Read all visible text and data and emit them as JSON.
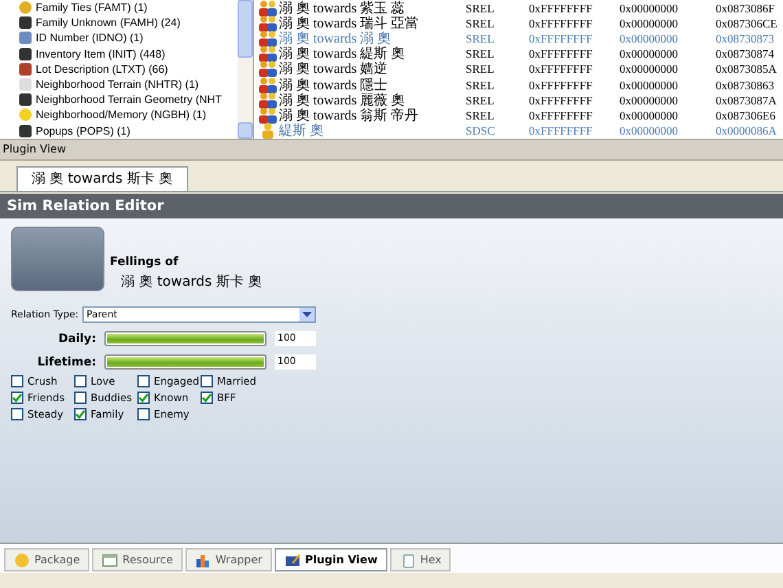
{
  "tree": {
    "items": [
      {
        "label": "Family Ties (FAMT) (1)",
        "kind": "people"
      },
      {
        "label": "Family Unknown (FAMH) (24)",
        "kind": "cube"
      },
      {
        "label": "ID Number (IDNO) (1)",
        "kind": "card"
      },
      {
        "label": "Inventory Item (INIT) (448)",
        "kind": "cube"
      },
      {
        "label": "Lot Description (LTXT) (66)",
        "kind": "house"
      },
      {
        "label": "Neighborhood Terrain (NHTR) (1)",
        "kind": "page"
      },
      {
        "label": "Neighborhood Terrain Geometry (NHT",
        "kind": "cube"
      },
      {
        "label": "Neighborhood/Memory (NGBH) (1)",
        "kind": "bulb"
      },
      {
        "label": "Popups (POPS) (1)",
        "kind": "cube"
      }
    ]
  },
  "resources": {
    "rows": [
      {
        "kind": "pair",
        "highlighted": false,
        "cells": [
          "溺 奧 towards 紫玉 蕊",
          "SREL",
          "0xFFFFFFFF",
          "0x00000000",
          "0x0873086F"
        ]
      },
      {
        "kind": "pair",
        "highlighted": false,
        "cells": [
          "溺 奧 towards 瑞斗 亞當",
          "SREL",
          "0xFFFFFFFF",
          "0x00000000",
          "0x087306CE"
        ]
      },
      {
        "kind": "pair",
        "highlighted": true,
        "cells": [
          "溺 奧 towards 溺 奧",
          "SREL",
          "0xFFFFFFFF",
          "0x00000000",
          "0x08730873"
        ]
      },
      {
        "kind": "pair",
        "highlighted": false,
        "cells": [
          "溺 奧 towards 緹斯 奧",
          "SREL",
          "0xFFFFFFFF",
          "0x00000000",
          "0x08730874"
        ]
      },
      {
        "kind": "pair",
        "highlighted": false,
        "cells": [
          "溺 奧 towards 嫱逆",
          "SREL",
          "0xFFFFFFFF",
          "0x00000000",
          "0x0873085A"
        ]
      },
      {
        "kind": "pair",
        "highlighted": false,
        "cells": [
          "溺 奧 towards 隱士",
          "SREL",
          "0xFFFFFFFF",
          "0x00000000",
          "0x08730863"
        ]
      },
      {
        "kind": "pair",
        "highlighted": false,
        "cells": [
          "溺 奧 towards 麗薇 奧",
          "SREL",
          "0xFFFFFFFF",
          "0x00000000",
          "0x0873087A"
        ]
      },
      {
        "kind": "pair",
        "highlighted": false,
        "cells": [
          "溺 奧 towards 翁斯 帝丹",
          "SREL",
          "0xFFFFFFFF",
          "0x00000000",
          "0x087306E6"
        ]
      },
      {
        "kind": "single",
        "highlighted": true,
        "cells": [
          "緹斯 奧",
          "SDSC",
          "0xFFFFFFFF",
          "0x00000000",
          "0x0000086A"
        ]
      }
    ]
  },
  "plugin_view": {
    "title": "Plugin View",
    "tab": "溺 奧 towards 斯卡 奧"
  },
  "editor": {
    "title": "Sim Relation Editor",
    "heading": "Fellings of",
    "subject": "溺 奧 towards 斯卡 奧",
    "relation_type": {
      "label": "Relation Type:",
      "value": "Parent"
    },
    "meters": [
      {
        "label": "Daily:",
        "level": 1.0,
        "reading": "100"
      },
      {
        "label": "Lifetime:",
        "level": 1.0,
        "reading": "100"
      }
    ],
    "flags": [
      {
        "label": "Crush",
        "checked": false
      },
      {
        "label": "Love",
        "checked": false
      },
      {
        "label": "Engaged",
        "checked": false
      },
      {
        "label": "Married",
        "checked": false
      },
      {
        "label": "Friends",
        "checked": true
      },
      {
        "label": "Buddies",
        "checked": false
      },
      {
        "label": "Known",
        "checked": true
      },
      {
        "label": "BFF",
        "checked": true
      },
      {
        "label": "Steady",
        "checked": false
      },
      {
        "label": "Family",
        "checked": true
      },
      {
        "label": "Enemy",
        "checked": false
      }
    ]
  },
  "bottom_tabs": [
    {
      "label": "Package",
      "kind": "package",
      "selected": false
    },
    {
      "label": "Resource",
      "kind": "resource",
      "selected": false
    },
    {
      "label": "Wrapper",
      "kind": "wrapper",
      "selected": false
    },
    {
      "label": "Plugin View",
      "kind": "plugin",
      "selected": true
    },
    {
      "label": "Hex",
      "kind": "hex",
      "selected": false
    }
  ]
}
